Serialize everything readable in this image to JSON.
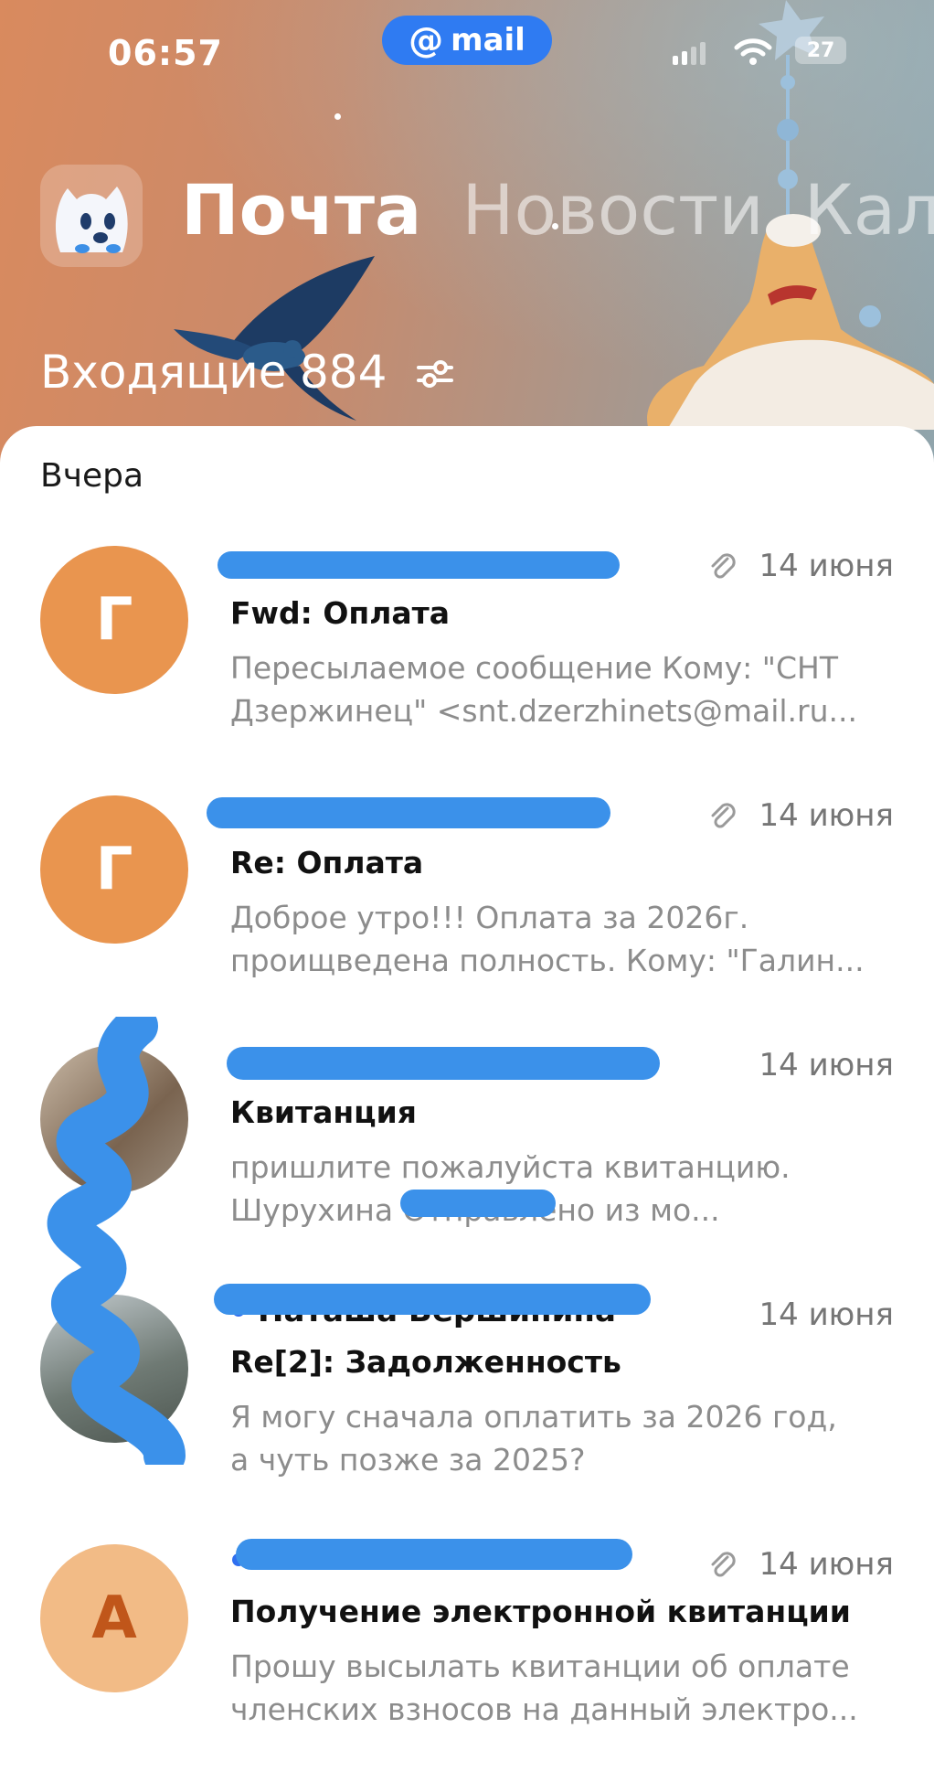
{
  "status": {
    "time": "06:57",
    "mail_pill": {
      "at": "@",
      "label": "mail"
    },
    "battery": "27"
  },
  "app_tabs": [
    {
      "label": "Почта",
      "active": true
    },
    {
      "label": "Новости",
      "active": false
    },
    {
      "label": "Кален",
      "active": false
    }
  ],
  "folder": {
    "title": "Входящие",
    "count": "884"
  },
  "section_label": "Вчера",
  "emails": [
    {
      "avatar_letter": "Г",
      "avatar_color": "#e9954f",
      "unread": true,
      "attachment": true,
      "date": "14 июня",
      "subject": "Fwd: Оплата",
      "preview_line1": "Пересылаемое сообщение Кому: \"СНТ",
      "preview_line2": "Дзержинец\" <snt.dzerzhinets@mail.ru..."
    },
    {
      "avatar_letter": "Г",
      "avatar_color": "#e9954f",
      "unread": true,
      "attachment": true,
      "date": "14 июня",
      "subject": "Re: Оплата",
      "preview_line1": "Доброе утро!!! Оплата за 2026г.",
      "preview_line2": "проищведена полность. Кому: \"Галин..."
    },
    {
      "avatar_letter": "",
      "avatar_color": "#8a7a6a",
      "unread": true,
      "attachment": false,
      "date": "14 июня",
      "subject": "Квитанция",
      "preview_line1": "пришлите пожалуйста квитанцию.",
      "preview_line2": "Шурухина Отправлено из мо..."
    },
    {
      "avatar_letter": "",
      "avatar_color": "#7d8a8a",
      "unread": true,
      "attachment": false,
      "date": "14 июня",
      "sender": "Наташа Вершинина",
      "subject": "Re[2]: Задолженность",
      "preview_line1": "Я могу сначала оплатить за 2026 год,",
      "preview_line2": "а чуть позже за 2025?"
    },
    {
      "avatar_letter": "А",
      "avatar_color": "#f2bb86",
      "unread": true,
      "attachment": true,
      "date": "14 июня",
      "subject": "Получение электронной квитанции",
      "preview_line1": "Прошу высылать квитанции об оплате",
      "preview_line2": "членских взносов на данный электро..."
    }
  ]
}
